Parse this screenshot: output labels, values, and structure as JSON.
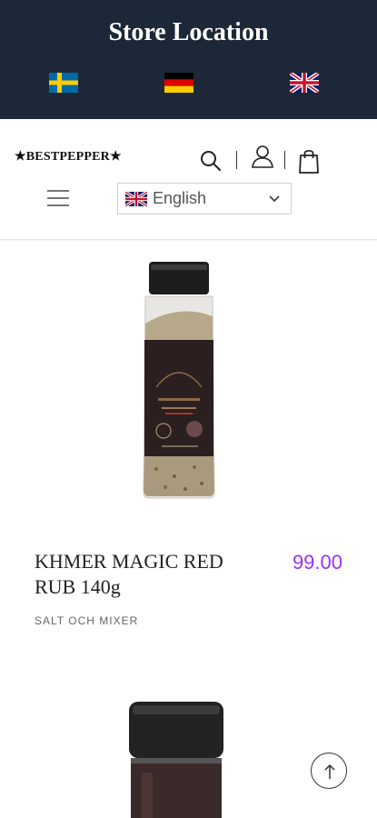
{
  "topbar": {
    "title": "Store Location",
    "flags": [
      "sweden-flag-icon",
      "germany-flag-icon",
      "uk-flag-icon"
    ]
  },
  "header": {
    "logo": "★BESTPEPPER★",
    "icons": [
      "search-icon",
      "user-icon",
      "shopping-bag-icon",
      "hamburger-menu-icon"
    ],
    "language": {
      "selected": "English",
      "flag": "uk-flag-icon"
    }
  },
  "product": {
    "title": "KHMER MAGIC RED RUB 140g",
    "price": "99.00",
    "category": "SALT OCH MIXER",
    "image": "spice-jar-image",
    "price_color": "#9b30ff"
  },
  "colors": {
    "topbar_bg": "#1c2837",
    "accent": "#9b30ff"
  },
  "scroll_top": {
    "icon": "arrow-up-icon"
  }
}
